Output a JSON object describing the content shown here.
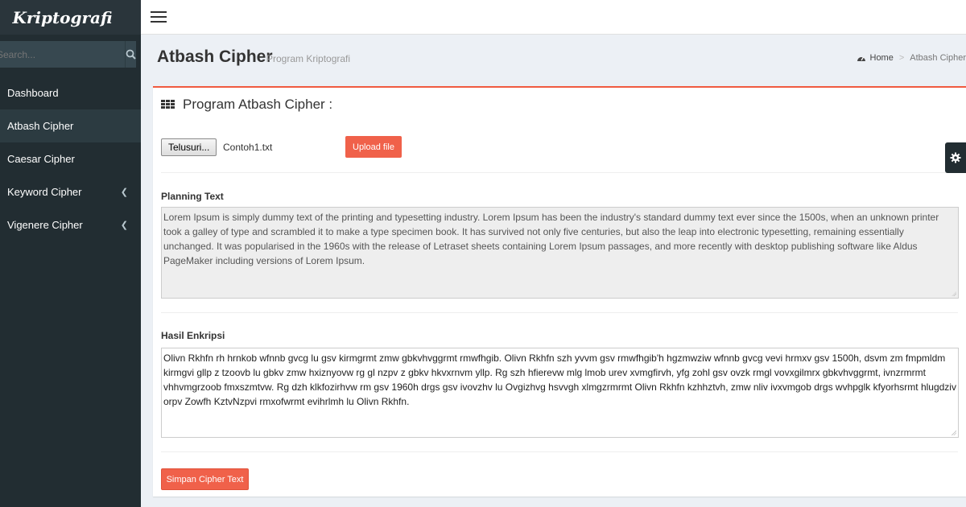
{
  "app": {
    "logo": "Kriptografi"
  },
  "search": {
    "placeholder": "Search..."
  },
  "sidebar": {
    "items": [
      {
        "label": "Dashboard",
        "active": false,
        "has_submenu": false
      },
      {
        "label": "Atbash Cipher",
        "active": true,
        "has_submenu": false
      },
      {
        "label": "Caesar Cipher",
        "active": false,
        "has_submenu": false
      },
      {
        "label": "Keyword Cipher",
        "active": false,
        "has_submenu": true
      },
      {
        "label": "Vigenere Cipher",
        "active": false,
        "has_submenu": true
      }
    ]
  },
  "page": {
    "title": "Atbash Cipher",
    "subtitle": "Program Kriptografi",
    "breadcrumb": {
      "home": "Home",
      "current": "Atbash Cipher"
    }
  },
  "box": {
    "title": "Program Atbash Cipher :",
    "file_button": "Telusuri...",
    "file_name": "Contoh1.txt",
    "upload_button": "Upload file",
    "plain_label": "Planning Text",
    "plain_text": "Lorem Ipsum is simply dummy text of the printing and typesetting industry. Lorem Ipsum has been the industry's standard dummy text ever since the 1500s, when an unknown printer took a galley of type and scrambled it to make a type specimen book. It has survived not only five centuries, but also the leap into electronic typesetting, remaining essentially unchanged. It was popularised in the 1960s with the release of Letraset sheets containing Lorem Ipsum passages, and more recently with desktop publishing software like Aldus PageMaker including versions of Lorem Ipsum.",
    "cipher_label": "Hasil Enkripsi",
    "cipher_text": "Olivn Rkhfn rh hrnkob wfnnb gvcg lu gsv kirmgrmt zmw gbkvhvggrmt rmwfhgib. Olivn Rkhfn szh yvvm gsv rmwfhgib'h hgzmwziw wfnnb gvcg vevi hrmxv gsv 1500h, dsvm zm fmpmldm kirmgvi gllp z tzoovb lu gbkv zmw hxiznyovw rg gl nzpv z gbkv hkvxrnvm yllp. Rg szh hfierevw mlg lmob urev xvmgfirvh, yfg zohl gsv ovzk rmgl vovxgilmrx gbkvhvggrmt, ivnzrmrmt vhhvmgrzoob fmxszmtvw. Rg dzh klkfozirhvw rm gsv 1960h drgs gsv ivovzhv lu Ovgizhvg hsvvgh xlmgzrmrmt Olivn Rkhfn kzhhztvh, zmw nliv ivxvmgob drgs wvhpglk kfyorhsrmt hlugdziv orpv Zowfh KztvNzpvi rmxofwrmt evihrlmh lu Olivn Rkhfn.",
    "save_button": "Simpan Cipher Text"
  },
  "colors": {
    "accent": "#f0614a",
    "sidebar_bg": "#222d32",
    "sidebar_active": "#2c3b41"
  },
  "icons": {
    "search": "search-icon",
    "menu": "hamburger-menu-icon",
    "home": "dashboard-icon",
    "grid": "th-grid-icon",
    "gear": "gear-icon",
    "chevron": "chevron-left-icon"
  }
}
